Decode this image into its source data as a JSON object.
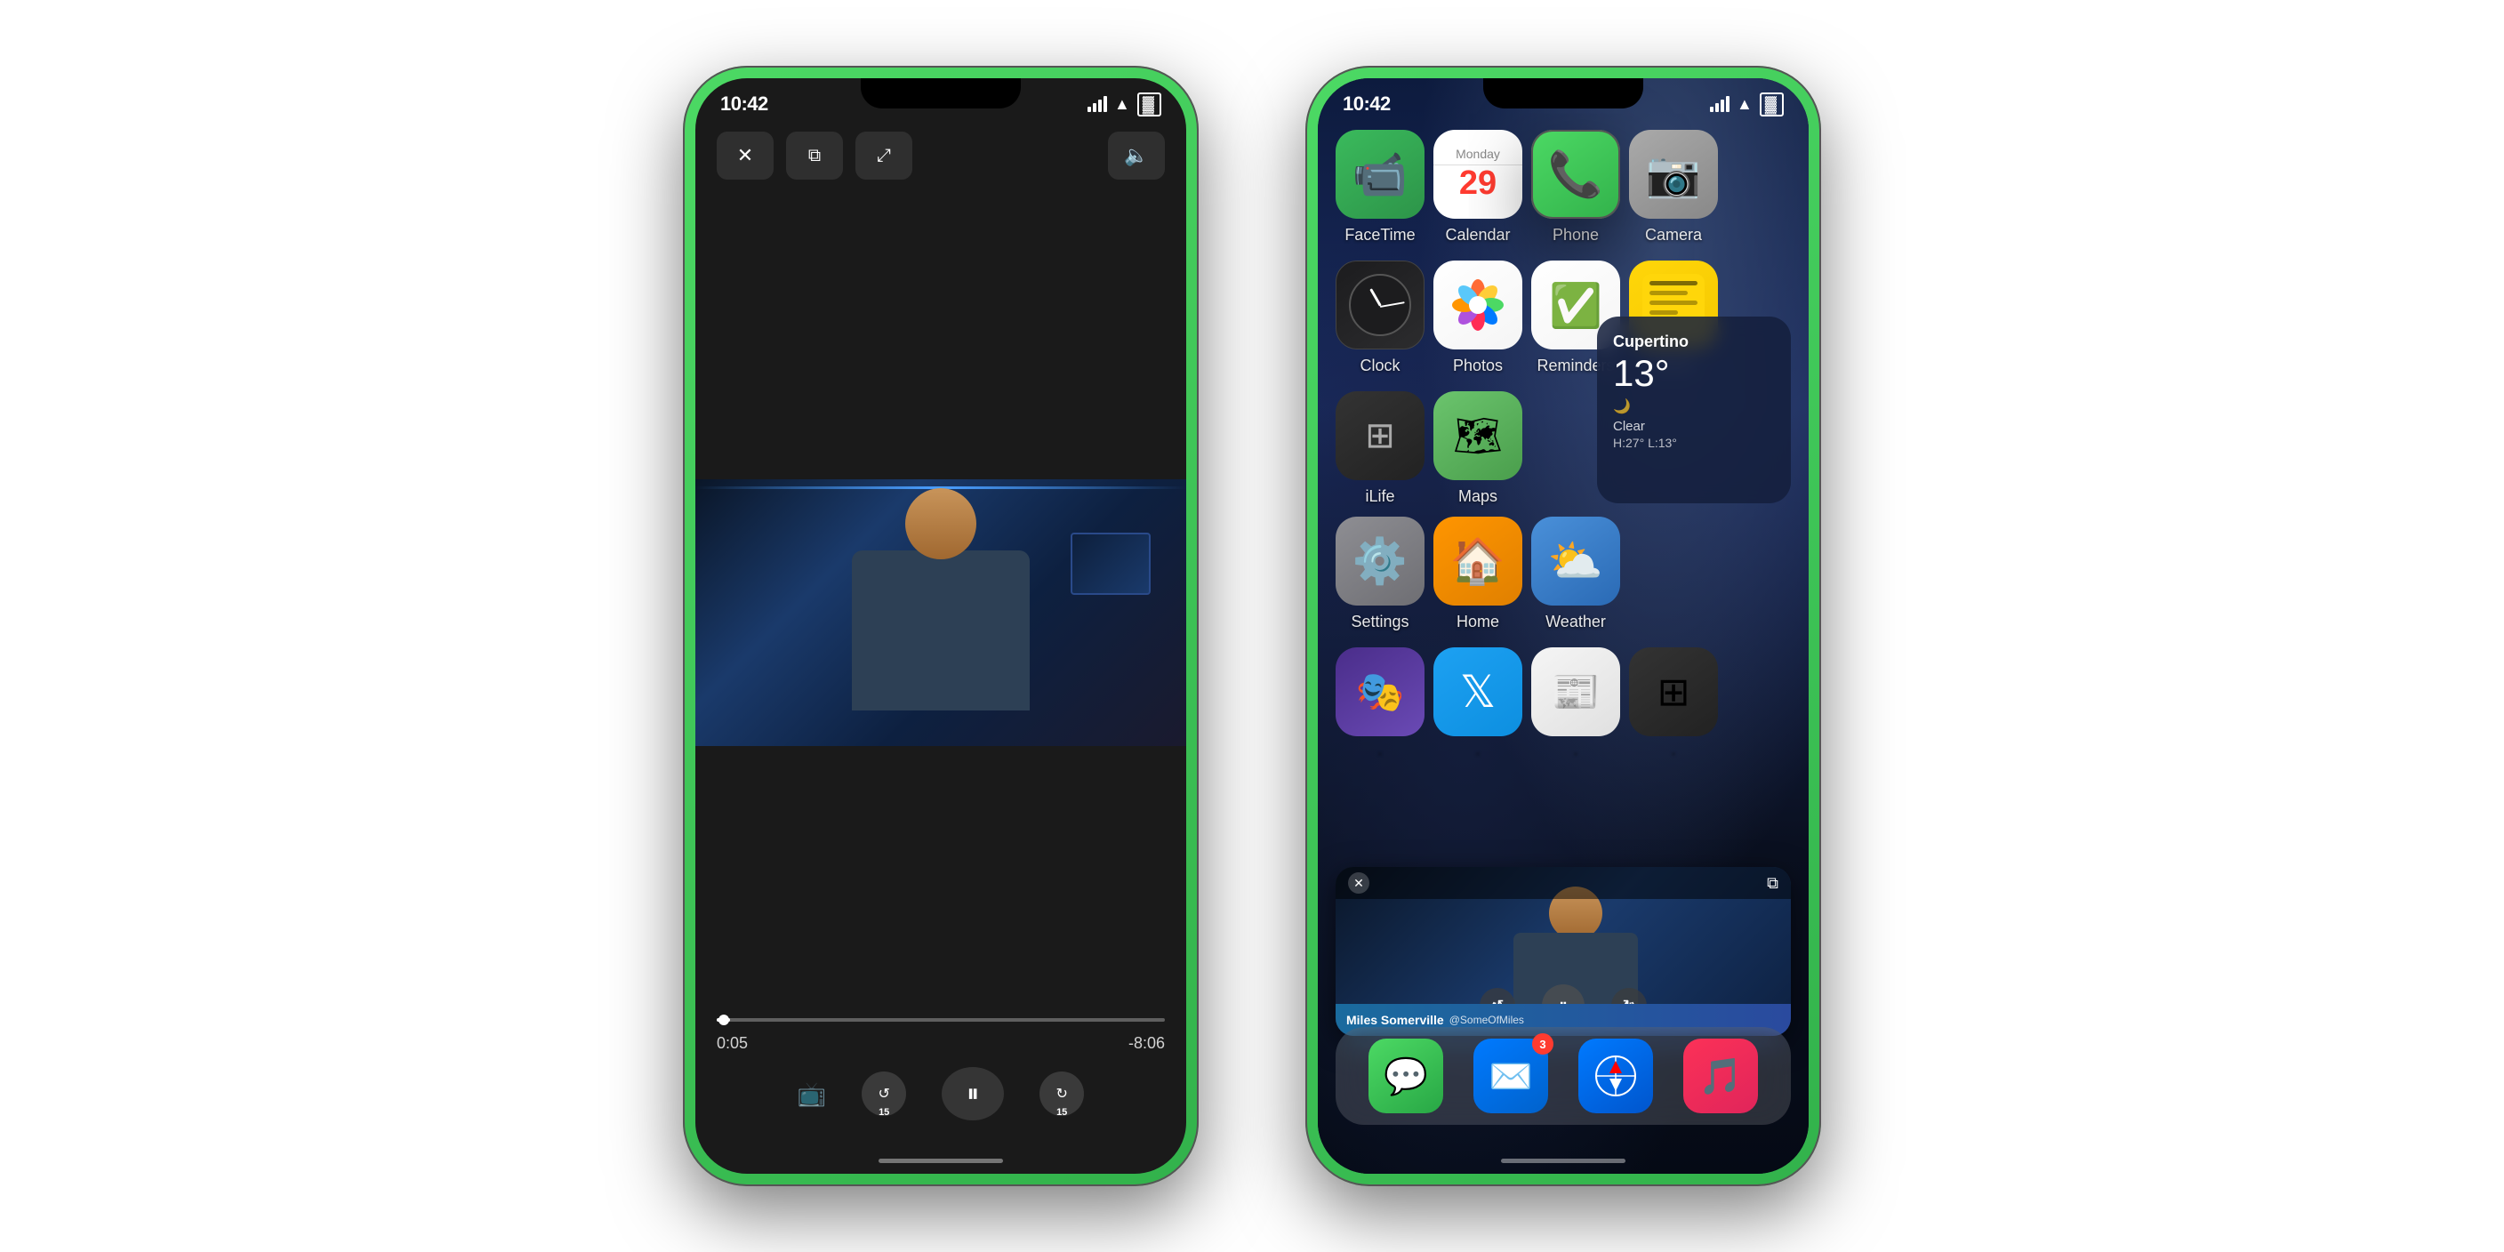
{
  "phone1": {
    "status": {
      "time": "10:42",
      "location": true
    },
    "controls": {
      "close_label": "✕",
      "pip_label": "⧉",
      "resize_label": "⤢",
      "volume_label": "🔈"
    },
    "video": {
      "current_time": "0:05",
      "remaining_time": "-8:06"
    },
    "playback": {
      "rewind_label": "15",
      "pause_label": "⏸",
      "forward_label": "15",
      "cast_label": "⬛"
    }
  },
  "phone2": {
    "status": {
      "time": "10:42"
    },
    "row1": [
      {
        "name": "FaceTime",
        "icon": "facetime"
      },
      {
        "name": "Calendar",
        "icon": "calendar",
        "day": "Monday",
        "date": "29"
      },
      {
        "name": "Phone",
        "icon": "phone"
      },
      {
        "name": "Camera",
        "icon": "camera"
      }
    ],
    "row2": [
      {
        "name": "Clock",
        "icon": "clock"
      },
      {
        "name": "Photos",
        "icon": "photos"
      },
      {
        "name": "Reminders",
        "icon": "reminders"
      },
      {
        "name": "Notes",
        "icon": "notes"
      }
    ],
    "row3_left": [
      {
        "name": "iLife",
        "icon": "ilife"
      },
      {
        "name": "Maps",
        "icon": "maps"
      }
    ],
    "weather": {
      "city": "Cupertino",
      "temp": "13°",
      "condition": "Clear",
      "high": "H:27°",
      "low": "L:13°"
    },
    "row4": [
      {
        "name": "Settings",
        "icon": "settings"
      },
      {
        "name": "Home",
        "icon": "home"
      },
      {
        "name": "Weather",
        "icon": "weather_app"
      }
    ],
    "row5_apps": [
      {
        "name": "",
        "icon": "app1"
      },
      {
        "name": "",
        "icon": "twitter"
      },
      {
        "name": "",
        "icon": "news"
      },
      {
        "name": "",
        "icon": "grid"
      }
    ],
    "pip": {
      "name": "Miles Somerville",
      "handle": "@SomeOfMiles"
    },
    "dock": [
      {
        "name": "Messages",
        "icon": "messages"
      },
      {
        "name": "Mail",
        "icon": "mail",
        "badge": "3"
      },
      {
        "name": "Safari",
        "icon": "safari"
      },
      {
        "name": "Music",
        "icon": "music"
      }
    ]
  }
}
